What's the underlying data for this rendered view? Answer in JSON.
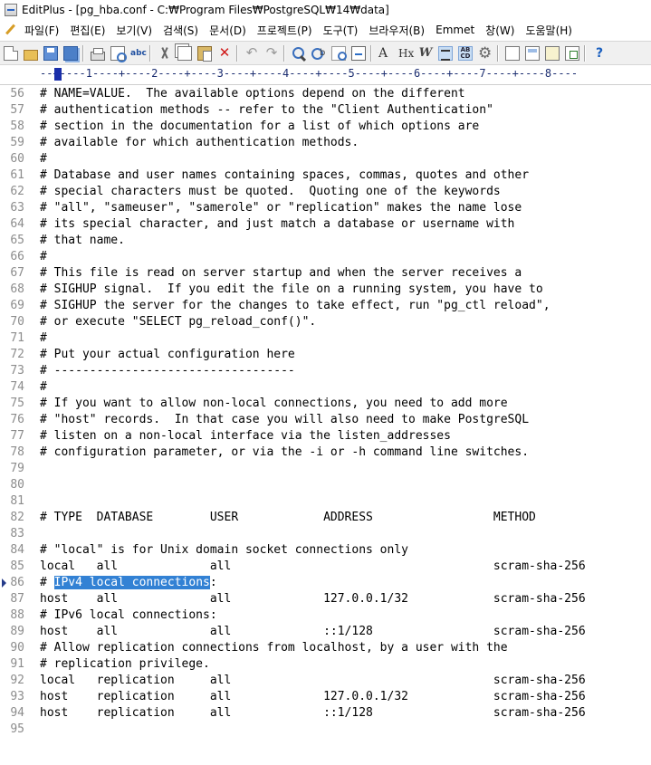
{
  "window": {
    "title": "EditPlus - [pg_hba.conf - C:₩Program Files₩PostgreSQL₩14₩data]"
  },
  "menu": [
    "파일(F)",
    "편집(E)",
    "보기(V)",
    "검색(S)",
    "문서(D)",
    "프로젝트(P)",
    "도구(T)",
    "브라우저(B)",
    "Emmet",
    "창(W)",
    "도움말(H)"
  ],
  "ruler": "--+----1----+----2----+----3----+----4----+----5----+----6----+----7----+----8----",
  "editor": {
    "selection_text": "IPv4 local connections",
    "lines": [
      {
        "n": "56",
        "text": "# NAME=VALUE.  The available options depend on the different"
      },
      {
        "n": "57",
        "text": "# authentication methods -- refer to the \"Client Authentication\""
      },
      {
        "n": "58",
        "text": "# section in the documentation for a list of which options are"
      },
      {
        "n": "59",
        "text": "# available for which authentication methods."
      },
      {
        "n": "60",
        "text": "#"
      },
      {
        "n": "61",
        "text": "# Database and user names containing spaces, commas, quotes and other"
      },
      {
        "n": "62",
        "text": "# special characters must be quoted.  Quoting one of the keywords"
      },
      {
        "n": "63",
        "text": "# \"all\", \"sameuser\", \"samerole\" or \"replication\" makes the name lose"
      },
      {
        "n": "64",
        "text": "# its special character, and just match a database or username with"
      },
      {
        "n": "65",
        "text": "# that name."
      },
      {
        "n": "66",
        "text": "#"
      },
      {
        "n": "67",
        "text": "# This file is read on server startup and when the server receives a"
      },
      {
        "n": "68",
        "text": "# SIGHUP signal.  If you edit the file on a running system, you have to"
      },
      {
        "n": "69",
        "text": "# SIGHUP the server for the changes to take effect, run \"pg_ctl reload\","
      },
      {
        "n": "70",
        "text": "# or execute \"SELECT pg_reload_conf()\"."
      },
      {
        "n": "71",
        "text": "#"
      },
      {
        "n": "72",
        "text": "# Put your actual configuration here"
      },
      {
        "n": "73",
        "text": "# ----------------------------------"
      },
      {
        "n": "74",
        "text": "#"
      },
      {
        "n": "75",
        "text": "# If you want to allow non-local connections, you need to add more"
      },
      {
        "n": "76",
        "text": "# \"host\" records.  In that case you will also need to make PostgreSQL"
      },
      {
        "n": "77",
        "text": "# listen on a non-local interface via the listen_addresses"
      },
      {
        "n": "78",
        "text": "# configuration parameter, or via the -i or -h command line switches."
      },
      {
        "n": "79",
        "text": ""
      },
      {
        "n": "80",
        "text": ""
      },
      {
        "n": "81",
        "text": ""
      },
      {
        "n": "82",
        "text": "# TYPE  DATABASE        USER            ADDRESS                 METHOD"
      },
      {
        "n": "83",
        "text": ""
      },
      {
        "n": "84",
        "text": "# \"local\" is for Unix domain socket connections only"
      },
      {
        "n": "85",
        "text": "local   all             all                                     scram-sha-256"
      },
      {
        "n": "86",
        "pre": "# ",
        "sel": "IPv4 local connections",
        "post": ":",
        "marker": true
      },
      {
        "n": "87",
        "text": "host    all             all             127.0.0.1/32            scram-sha-256"
      },
      {
        "n": "88",
        "text": "# IPv6 local connections:"
      },
      {
        "n": "89",
        "text": "host    all             all             ::1/128                 scram-sha-256"
      },
      {
        "n": "90",
        "text": "# Allow replication connections from localhost, by a user with the"
      },
      {
        "n": "91",
        "text": "# replication privilege."
      },
      {
        "n": "92",
        "text": "local   replication     all                                     scram-sha-256"
      },
      {
        "n": "93",
        "text": "host    replication     all             127.0.0.1/32            scram-sha-256"
      },
      {
        "n": "94",
        "text": "host    replication     all             ::1/128                 scram-sha-256"
      },
      {
        "n": "95",
        "text": ""
      }
    ]
  }
}
